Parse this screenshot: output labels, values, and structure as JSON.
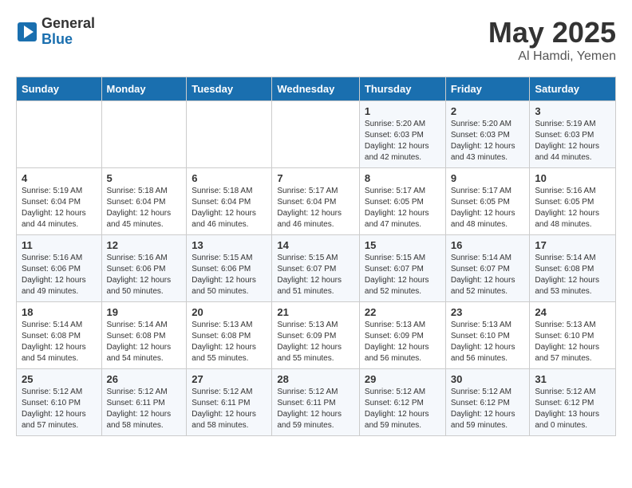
{
  "header": {
    "logo_general": "General",
    "logo_blue": "Blue",
    "month": "May 2025",
    "location": "Al Hamdi, Yemen"
  },
  "days_of_week": [
    "Sunday",
    "Monday",
    "Tuesday",
    "Wednesday",
    "Thursday",
    "Friday",
    "Saturday"
  ],
  "weeks": [
    [
      {
        "day": "",
        "info": ""
      },
      {
        "day": "",
        "info": ""
      },
      {
        "day": "",
        "info": ""
      },
      {
        "day": "",
        "info": ""
      },
      {
        "day": "1",
        "info": "Sunrise: 5:20 AM\nSunset: 6:03 PM\nDaylight: 12 hours\nand 42 minutes."
      },
      {
        "day": "2",
        "info": "Sunrise: 5:20 AM\nSunset: 6:03 PM\nDaylight: 12 hours\nand 43 minutes."
      },
      {
        "day": "3",
        "info": "Sunrise: 5:19 AM\nSunset: 6:03 PM\nDaylight: 12 hours\nand 44 minutes."
      }
    ],
    [
      {
        "day": "4",
        "info": "Sunrise: 5:19 AM\nSunset: 6:04 PM\nDaylight: 12 hours\nand 44 minutes."
      },
      {
        "day": "5",
        "info": "Sunrise: 5:18 AM\nSunset: 6:04 PM\nDaylight: 12 hours\nand 45 minutes."
      },
      {
        "day": "6",
        "info": "Sunrise: 5:18 AM\nSunset: 6:04 PM\nDaylight: 12 hours\nand 46 minutes."
      },
      {
        "day": "7",
        "info": "Sunrise: 5:17 AM\nSunset: 6:04 PM\nDaylight: 12 hours\nand 46 minutes."
      },
      {
        "day": "8",
        "info": "Sunrise: 5:17 AM\nSunset: 6:05 PM\nDaylight: 12 hours\nand 47 minutes."
      },
      {
        "day": "9",
        "info": "Sunrise: 5:17 AM\nSunset: 6:05 PM\nDaylight: 12 hours\nand 48 minutes."
      },
      {
        "day": "10",
        "info": "Sunrise: 5:16 AM\nSunset: 6:05 PM\nDaylight: 12 hours\nand 48 minutes."
      }
    ],
    [
      {
        "day": "11",
        "info": "Sunrise: 5:16 AM\nSunset: 6:06 PM\nDaylight: 12 hours\nand 49 minutes."
      },
      {
        "day": "12",
        "info": "Sunrise: 5:16 AM\nSunset: 6:06 PM\nDaylight: 12 hours\nand 50 minutes."
      },
      {
        "day": "13",
        "info": "Sunrise: 5:15 AM\nSunset: 6:06 PM\nDaylight: 12 hours\nand 50 minutes."
      },
      {
        "day": "14",
        "info": "Sunrise: 5:15 AM\nSunset: 6:07 PM\nDaylight: 12 hours\nand 51 minutes."
      },
      {
        "day": "15",
        "info": "Sunrise: 5:15 AM\nSunset: 6:07 PM\nDaylight: 12 hours\nand 52 minutes."
      },
      {
        "day": "16",
        "info": "Sunrise: 5:14 AM\nSunset: 6:07 PM\nDaylight: 12 hours\nand 52 minutes."
      },
      {
        "day": "17",
        "info": "Sunrise: 5:14 AM\nSunset: 6:08 PM\nDaylight: 12 hours\nand 53 minutes."
      }
    ],
    [
      {
        "day": "18",
        "info": "Sunrise: 5:14 AM\nSunset: 6:08 PM\nDaylight: 12 hours\nand 54 minutes."
      },
      {
        "day": "19",
        "info": "Sunrise: 5:14 AM\nSunset: 6:08 PM\nDaylight: 12 hours\nand 54 minutes."
      },
      {
        "day": "20",
        "info": "Sunrise: 5:13 AM\nSunset: 6:08 PM\nDaylight: 12 hours\nand 55 minutes."
      },
      {
        "day": "21",
        "info": "Sunrise: 5:13 AM\nSunset: 6:09 PM\nDaylight: 12 hours\nand 55 minutes."
      },
      {
        "day": "22",
        "info": "Sunrise: 5:13 AM\nSunset: 6:09 PM\nDaylight: 12 hours\nand 56 minutes."
      },
      {
        "day": "23",
        "info": "Sunrise: 5:13 AM\nSunset: 6:10 PM\nDaylight: 12 hours\nand 56 minutes."
      },
      {
        "day": "24",
        "info": "Sunrise: 5:13 AM\nSunset: 6:10 PM\nDaylight: 12 hours\nand 57 minutes."
      }
    ],
    [
      {
        "day": "25",
        "info": "Sunrise: 5:12 AM\nSunset: 6:10 PM\nDaylight: 12 hours\nand 57 minutes."
      },
      {
        "day": "26",
        "info": "Sunrise: 5:12 AM\nSunset: 6:11 PM\nDaylight: 12 hours\nand 58 minutes."
      },
      {
        "day": "27",
        "info": "Sunrise: 5:12 AM\nSunset: 6:11 PM\nDaylight: 12 hours\nand 58 minutes."
      },
      {
        "day": "28",
        "info": "Sunrise: 5:12 AM\nSunset: 6:11 PM\nDaylight: 12 hours\nand 59 minutes."
      },
      {
        "day": "29",
        "info": "Sunrise: 5:12 AM\nSunset: 6:12 PM\nDaylight: 12 hours\nand 59 minutes."
      },
      {
        "day": "30",
        "info": "Sunrise: 5:12 AM\nSunset: 6:12 PM\nDaylight: 12 hours\nand 59 minutes."
      },
      {
        "day": "31",
        "info": "Sunrise: 5:12 AM\nSunset: 6:12 PM\nDaylight: 13 hours\nand 0 minutes."
      }
    ]
  ]
}
